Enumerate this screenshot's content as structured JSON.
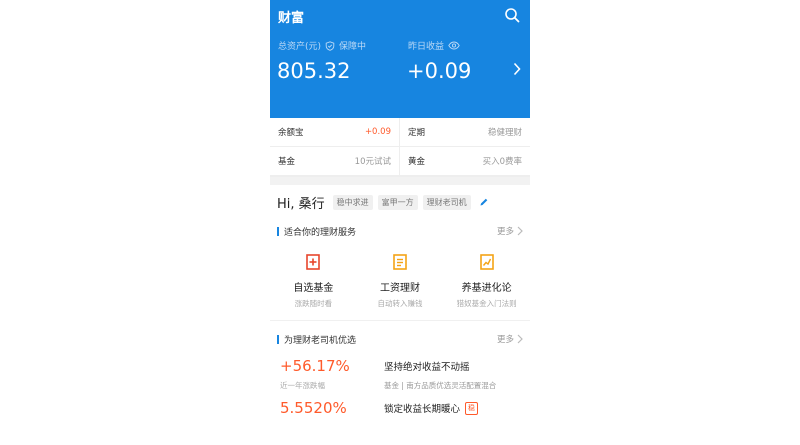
{
  "header": {
    "title": "财富",
    "total_assets_label": "总资产(元)",
    "protection_label": "保障中",
    "total_assets_value": "805.32",
    "yesterday_label": "昨日收益",
    "yesterday_value": "+0.09",
    "accent_color": "#1785e0"
  },
  "grid": [
    {
      "name": "余额宝",
      "value": "+0.09",
      "highlight": true
    },
    {
      "name": "定期",
      "value": "稳健理财",
      "highlight": false
    },
    {
      "name": "基金",
      "value": "10元试试",
      "highlight": false
    },
    {
      "name": "黄金",
      "value": "买入0费率",
      "highlight": false
    }
  ],
  "greeting": {
    "hi": "Hi, 桑行",
    "tags": [
      "稳中求进",
      "富甲一方",
      "理财老司机"
    ]
  },
  "services_section": {
    "title": "适合你的理财服务",
    "more": "更多",
    "items": [
      {
        "title": "自选基金",
        "subtitle": "涨跌随时看",
        "icon": "fund-icon",
        "color": "#e8462c"
      },
      {
        "title": "工资理财",
        "subtitle": "自动转入赚钱",
        "icon": "document-icon",
        "color": "#f4a316"
      },
      {
        "title": "养基进化论",
        "subtitle": "猎奴基金入门法则",
        "icon": "trend-chart-icon",
        "color": "#f4a316"
      }
    ]
  },
  "picks_section": {
    "title": "为理财老司机优选",
    "more": "更多",
    "items": [
      {
        "rate": "+56.17%",
        "rate_label": "近一年涨跌幅",
        "title": "坚持绝对收益不动摇",
        "desc": "基金 | 南方品质优选灵活配置混合",
        "badge": ""
      },
      {
        "rate": "5.5520%",
        "rate_label": "",
        "title": "锁定收益长期暖心",
        "desc": "",
        "badge": "稳"
      }
    ]
  },
  "colors": {
    "positive": "#ff5a2b"
  }
}
